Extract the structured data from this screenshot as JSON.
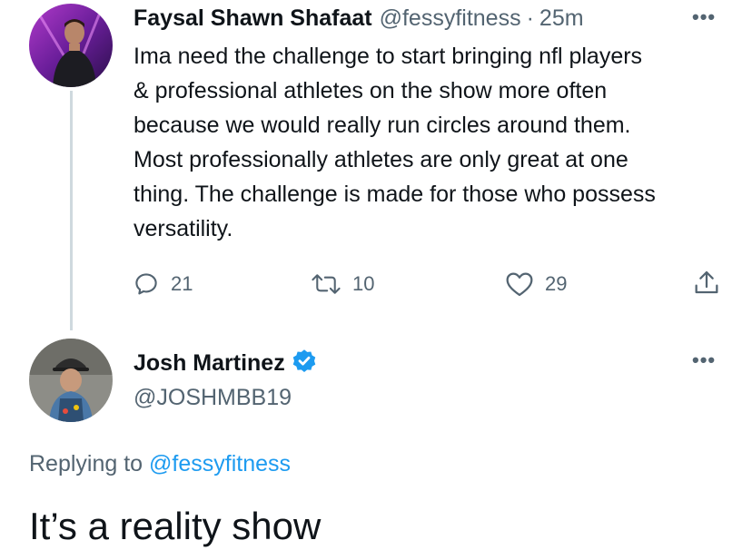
{
  "original_tweet": {
    "display_name": "Faysal Shawn Shafaat",
    "handle": "@fessyfitness",
    "separator": "·",
    "time": "25m",
    "text": "Ima need the challenge to start bringing nfl players\n& professional athletes on the show more often\nbecause we would really run circles around them.\nMost professionally athletes are only great at one\nthing. The challenge is made for those who possess\nversatility.",
    "more_icon": "more-horizontal-icon",
    "actions": {
      "reply_count": "21",
      "retweet_count": "10",
      "like_count": "29"
    }
  },
  "reply": {
    "display_name": "Josh Martinez",
    "handle": "@JOSHMBB19",
    "verified": true,
    "more_icon": "more-horizontal-icon",
    "replying_to_label": "Replying to",
    "replying_to_handle": "@fessyfitness",
    "text": "It’s a reality show"
  },
  "colors": {
    "text_primary": "#0f1419",
    "text_secondary": "#536471",
    "accent_blue": "#1d9bf0",
    "thread_line": "#cfd9de"
  }
}
